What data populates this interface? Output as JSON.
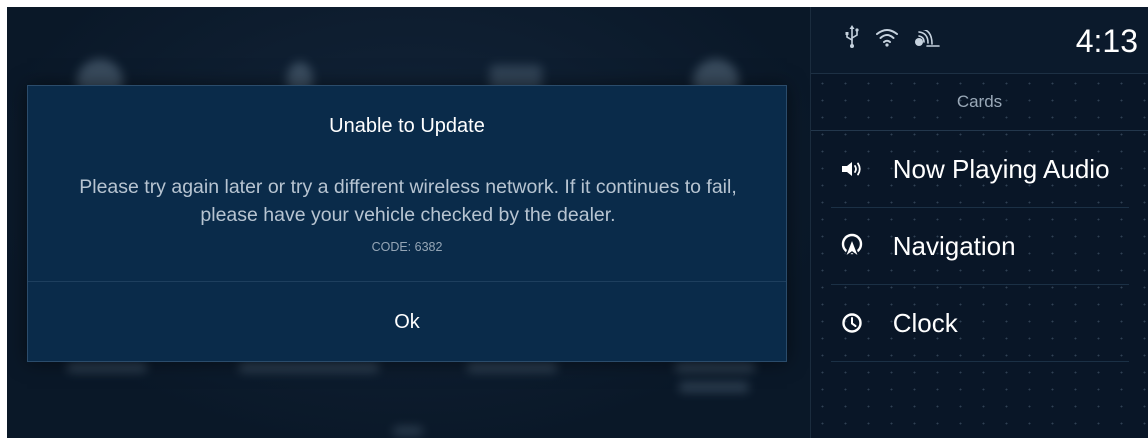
{
  "dialog": {
    "title": "Unable to Update",
    "message": "Please try again later or try a different wireless network. If it continues to fail, please have your vehicle checked by the dealer.",
    "code": "CODE: 6382",
    "ok_label": "Ok"
  },
  "status_bar": {
    "icons": [
      "usb-icon",
      "wifi-icon",
      "connected-services-icon"
    ],
    "time": "4:13"
  },
  "cards_panel": {
    "header": "Cards",
    "items": [
      {
        "label": "Now Playing Audio",
        "icon": "speaker-icon"
      },
      {
        "label": "Navigation",
        "icon": "navigation-icon"
      },
      {
        "label": "Clock",
        "icon": "clock-icon"
      }
    ]
  },
  "colors": {
    "dialog_bg": "#0a2b4a",
    "screen_bg": "#0a1828",
    "panel_bg": "#091627",
    "text_primary": "#ffffff",
    "text_secondary": "#b7c4d1"
  }
}
